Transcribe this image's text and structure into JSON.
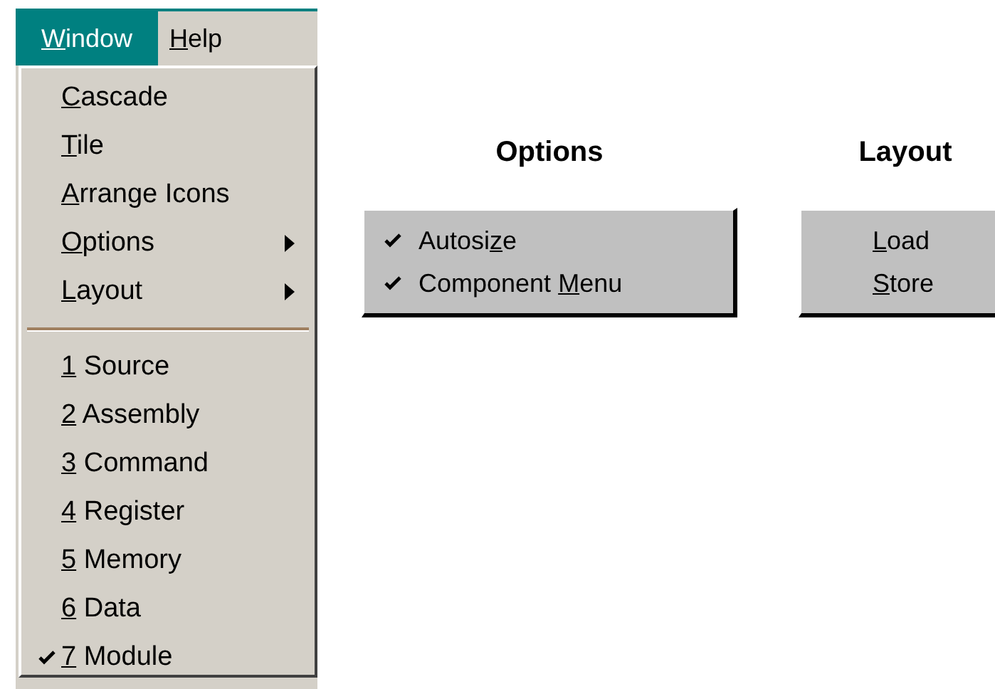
{
  "menu_bar": [
    {
      "selected": true,
      "label_parts": [
        {
          "text": "W",
          "underlined": true
        },
        {
          "text": "indow",
          "underlined": false
        }
      ]
    },
    {
      "selected": false,
      "label_parts": [
        {
          "text": "H",
          "underlined": true
        },
        {
          "text": "elp",
          "underlined": false
        }
      ]
    }
  ],
  "window_menu": [
    {
      "kind": "command",
      "checked": false,
      "label_parts": [
        {
          "text": "C",
          "underlined": true
        },
        {
          "text": "ascade",
          "underlined": false
        }
      ]
    },
    {
      "kind": "command",
      "checked": false,
      "label_parts": [
        {
          "text": "T",
          "underlined": true
        },
        {
          "text": "ile",
          "underlined": false
        }
      ]
    },
    {
      "kind": "command",
      "checked": false,
      "label_parts": [
        {
          "text": "A",
          "underlined": true
        },
        {
          "text": "rrange Icons",
          "underlined": false
        }
      ]
    },
    {
      "kind": "submenu",
      "checked": false,
      "label_parts": [
        {
          "text": "O",
          "underlined": true
        },
        {
          "text": "ptions",
          "underlined": false
        }
      ]
    },
    {
      "kind": "submenu",
      "checked": false,
      "label_parts": [
        {
          "text": "L",
          "underlined": true
        },
        {
          "text": "ayout",
          "underlined": false
        }
      ]
    },
    {
      "kind": "separator"
    },
    {
      "kind": "command",
      "checked": false,
      "label_parts": [
        {
          "text": "1",
          "underlined": true
        },
        {
          "text": " Source",
          "underlined": false
        }
      ]
    },
    {
      "kind": "command",
      "checked": false,
      "label_parts": [
        {
          "text": "2",
          "underlined": true
        },
        {
          "text": " Assembly",
          "underlined": false
        }
      ]
    },
    {
      "kind": "command",
      "checked": false,
      "label_parts": [
        {
          "text": "3",
          "underlined": true
        },
        {
          "text": " Command",
          "underlined": false
        }
      ]
    },
    {
      "kind": "command",
      "checked": false,
      "label_parts": [
        {
          "text": "4",
          "underlined": true
        },
        {
          "text": " Register",
          "underlined": false
        }
      ]
    },
    {
      "kind": "command",
      "checked": false,
      "label_parts": [
        {
          "text": "5",
          "underlined": true
        },
        {
          "text": " Memory",
          "underlined": false
        }
      ]
    },
    {
      "kind": "command",
      "checked": false,
      "label_parts": [
        {
          "text": "6",
          "underlined": true
        },
        {
          "text": " Data",
          "underlined": false
        }
      ]
    },
    {
      "kind": "command",
      "checked": true,
      "label_parts": [
        {
          "text": "7",
          "underlined": true
        },
        {
          "text": " Module",
          "underlined": false
        }
      ]
    }
  ],
  "submenus": [
    {
      "title": "Options",
      "items": [
        {
          "checked": true,
          "label_parts": [
            {
              "text": "Autosi",
              "underlined": false
            },
            {
              "text": "z",
              "underlined": true
            },
            {
              "text": "e",
              "underlined": false
            }
          ]
        },
        {
          "checked": true,
          "label_parts": [
            {
              "text": "Component ",
              "underlined": false
            },
            {
              "text": "M",
              "underlined": true
            },
            {
              "text": "enu",
              "underlined": false
            }
          ]
        }
      ]
    },
    {
      "title": "Layout",
      "items": [
        {
          "checked": false,
          "label_parts": [
            {
              "text": "L",
              "underlined": true
            },
            {
              "text": "oad",
              "underlined": false
            }
          ]
        },
        {
          "checked": false,
          "label_parts": [
            {
              "text": "S",
              "underlined": true
            },
            {
              "text": "tore",
              "underlined": false
            }
          ]
        }
      ]
    }
  ]
}
